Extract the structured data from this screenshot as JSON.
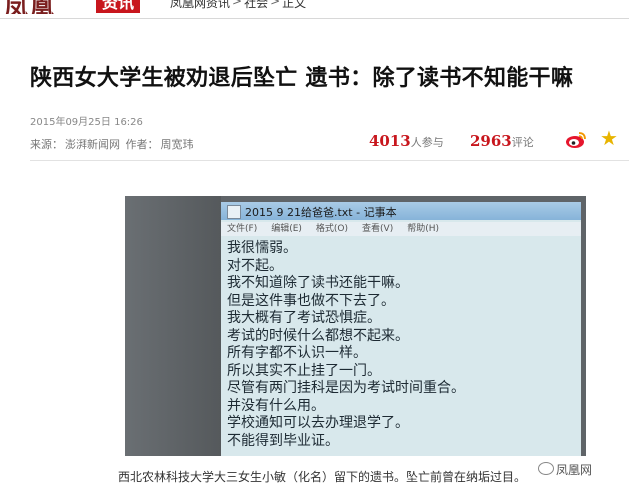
{
  "header": {
    "logo": "凤凰",
    "channel": "资讯",
    "breadcrumbs": [
      "凤凰网资讯",
      "社会",
      "正文"
    ]
  },
  "article": {
    "title": "陕西女大学生被劝退后坠亡 遗书：除了读书不知能干嘛",
    "pub_time": "2015年09月25日 16:26",
    "source_label": "来源：",
    "source": "澎湃新闻网",
    "author_label": "作者：",
    "author": "周宽玮"
  },
  "stats": {
    "participants": "4013",
    "participants_label": "人参与",
    "comments": "2963",
    "comments_label": "评论",
    "share_icon": "weibo-icon",
    "favorite_icon": "star-icon"
  },
  "photo": {
    "window_title": "2015 9 21给爸爸.txt - 记事本",
    "menu": [
      "文件(F)",
      "编辑(E)",
      "格式(O)",
      "查看(V)",
      "帮助(H)"
    ],
    "lines": [
      "我很懦弱。",
      "对不起。",
      "我不知道除了读书还能干嘛。",
      "但是这件事也做不下去了。",
      "我大概有了考试恐惧症。",
      "考试的时候什么都想不起来。",
      "所有字都不认识一样。",
      "所以其实不止挂了一门。",
      "尽管有两门挂科是因为考试时间重合。",
      "并没有什么用。",
      "学校通知可以去办理退学了。",
      "不能得到毕业证。"
    ],
    "caption": "西北农林科技大学大三女生小敏（化名）留下的遗书。坠亡前曾在纳垢过目。",
    "watermark": "凤凰网"
  },
  "colors": {
    "brand_red": "#c8161d",
    "star": "#e8b400"
  }
}
